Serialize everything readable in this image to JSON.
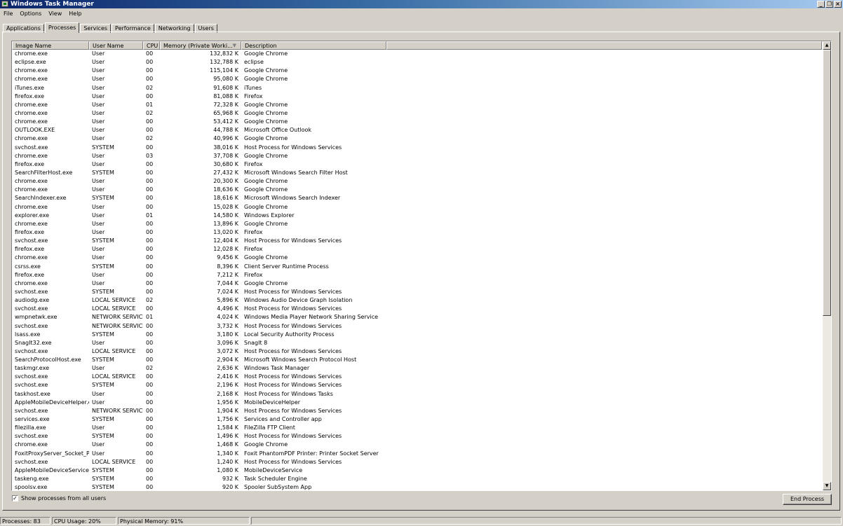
{
  "window": {
    "title": "Windows Task Manager"
  },
  "menu": [
    "File",
    "Options",
    "View",
    "Help"
  ],
  "tabs": [
    "Applications",
    "Processes",
    "Services",
    "Performance",
    "Networking",
    "Users"
  ],
  "active_tab": "Processes",
  "columns": [
    "Image Name",
    "User Name",
    "CPU",
    "Memory (Private Worki...",
    "Description"
  ],
  "processes": [
    {
      "name": "chrome.exe",
      "user": "User",
      "cpu": "00",
      "mem": "132,832 K",
      "desc": "Google Chrome"
    },
    {
      "name": "eclipse.exe",
      "user": "User",
      "cpu": "00",
      "mem": "132,788 K",
      "desc": "eclipse"
    },
    {
      "name": "chrome.exe",
      "user": "User",
      "cpu": "00",
      "mem": "115,104 K",
      "desc": "Google Chrome"
    },
    {
      "name": "chrome.exe",
      "user": "User",
      "cpu": "00",
      "mem": "95,080 K",
      "desc": "Google Chrome"
    },
    {
      "name": "iTunes.exe",
      "user": "User",
      "cpu": "02",
      "mem": "91,608 K",
      "desc": "iTunes"
    },
    {
      "name": "firefox.exe",
      "user": "User",
      "cpu": "00",
      "mem": "81,088 K",
      "desc": "Firefox"
    },
    {
      "name": "chrome.exe",
      "user": "User",
      "cpu": "01",
      "mem": "72,328 K",
      "desc": "Google Chrome"
    },
    {
      "name": "chrome.exe",
      "user": "User",
      "cpu": "02",
      "mem": "65,968 K",
      "desc": "Google Chrome"
    },
    {
      "name": "chrome.exe",
      "user": "User",
      "cpu": "00",
      "mem": "53,412 K",
      "desc": "Google Chrome"
    },
    {
      "name": "OUTLOOK.EXE",
      "user": "User",
      "cpu": "00",
      "mem": "44,788 K",
      "desc": "Microsoft Office Outlook"
    },
    {
      "name": "chrome.exe",
      "user": "User",
      "cpu": "02",
      "mem": "40,996 K",
      "desc": "Google Chrome"
    },
    {
      "name": "svchost.exe",
      "user": "SYSTEM",
      "cpu": "00",
      "mem": "38,016 K",
      "desc": "Host Process for Windows Services"
    },
    {
      "name": "chrome.exe",
      "user": "User",
      "cpu": "03",
      "mem": "37,708 K",
      "desc": "Google Chrome"
    },
    {
      "name": "firefox.exe",
      "user": "User",
      "cpu": "00",
      "mem": "30,680 K",
      "desc": "Firefox"
    },
    {
      "name": "SearchFilterHost.exe",
      "user": "SYSTEM",
      "cpu": "00",
      "mem": "27,432 K",
      "desc": "Microsoft Windows Search Filter Host"
    },
    {
      "name": "chrome.exe",
      "user": "User",
      "cpu": "00",
      "mem": "20,300 K",
      "desc": "Google Chrome"
    },
    {
      "name": "chrome.exe",
      "user": "User",
      "cpu": "00",
      "mem": "18,636 K",
      "desc": "Google Chrome"
    },
    {
      "name": "SearchIndexer.exe",
      "user": "SYSTEM",
      "cpu": "00",
      "mem": "18,616 K",
      "desc": "Microsoft Windows Search Indexer"
    },
    {
      "name": "chrome.exe",
      "user": "User",
      "cpu": "00",
      "mem": "15,028 K",
      "desc": "Google Chrome"
    },
    {
      "name": "explorer.exe",
      "user": "User",
      "cpu": "01",
      "mem": "14,580 K",
      "desc": "Windows Explorer"
    },
    {
      "name": "chrome.exe",
      "user": "User",
      "cpu": "00",
      "mem": "13,896 K",
      "desc": "Google Chrome"
    },
    {
      "name": "firefox.exe",
      "user": "User",
      "cpu": "00",
      "mem": "13,020 K",
      "desc": "Firefox"
    },
    {
      "name": "svchost.exe",
      "user": "SYSTEM",
      "cpu": "00",
      "mem": "12,404 K",
      "desc": "Host Process for Windows Services"
    },
    {
      "name": "firefox.exe",
      "user": "User",
      "cpu": "00",
      "mem": "12,028 K",
      "desc": "Firefox"
    },
    {
      "name": "chrome.exe",
      "user": "User",
      "cpu": "00",
      "mem": "9,456 K",
      "desc": "Google Chrome"
    },
    {
      "name": "csrss.exe",
      "user": "SYSTEM",
      "cpu": "00",
      "mem": "8,396 K",
      "desc": "Client Server Runtime Process"
    },
    {
      "name": "firefox.exe",
      "user": "User",
      "cpu": "00",
      "mem": "7,212 K",
      "desc": "Firefox"
    },
    {
      "name": "chrome.exe",
      "user": "User",
      "cpu": "00",
      "mem": "7,044 K",
      "desc": "Google Chrome"
    },
    {
      "name": "svchost.exe",
      "user": "SYSTEM",
      "cpu": "00",
      "mem": "7,024 K",
      "desc": "Host Process for Windows Services"
    },
    {
      "name": "audiodg.exe",
      "user": "LOCAL SERVICE",
      "cpu": "02",
      "mem": "5,896 K",
      "desc": "Windows Audio Device Graph Isolation"
    },
    {
      "name": "svchost.exe",
      "user": "LOCAL SERVICE",
      "cpu": "00",
      "mem": "4,496 K",
      "desc": "Host Process for Windows Services"
    },
    {
      "name": "wmpnetwk.exe",
      "user": "NETWORK SERVICE",
      "cpu": "01",
      "mem": "4,024 K",
      "desc": "Windows Media Player Network Sharing Service"
    },
    {
      "name": "svchost.exe",
      "user": "NETWORK SERVICE",
      "cpu": "00",
      "mem": "3,732 K",
      "desc": "Host Process for Windows Services"
    },
    {
      "name": "lsass.exe",
      "user": "SYSTEM",
      "cpu": "00",
      "mem": "3,180 K",
      "desc": "Local Security Authority Process"
    },
    {
      "name": "SnagIt32.exe",
      "user": "User",
      "cpu": "00",
      "mem": "3,096 K",
      "desc": "SnagIt 8"
    },
    {
      "name": "svchost.exe",
      "user": "LOCAL SERVICE",
      "cpu": "00",
      "mem": "3,072 K",
      "desc": "Host Process for Windows Services"
    },
    {
      "name": "SearchProtocolHost.exe",
      "user": "SYSTEM",
      "cpu": "00",
      "mem": "2,904 K",
      "desc": "Microsoft Windows Search Protocol Host"
    },
    {
      "name": "taskmgr.exe",
      "user": "User",
      "cpu": "02",
      "mem": "2,636 K",
      "desc": "Windows Task Manager"
    },
    {
      "name": "svchost.exe",
      "user": "LOCAL SERVICE",
      "cpu": "00",
      "mem": "2,416 K",
      "desc": "Host Process for Windows Services"
    },
    {
      "name": "svchost.exe",
      "user": "SYSTEM",
      "cpu": "00",
      "mem": "2,196 K",
      "desc": "Host Process for Windows Services"
    },
    {
      "name": "taskhost.exe",
      "user": "User",
      "cpu": "00",
      "mem": "2,168 K",
      "desc": "Host Process for Windows Tasks"
    },
    {
      "name": "AppleMobileDeviceHelper.exe",
      "user": "User",
      "cpu": "00",
      "mem": "1,956 K",
      "desc": "MobileDeviceHelper"
    },
    {
      "name": "svchost.exe",
      "user": "NETWORK SERVICE",
      "cpu": "00",
      "mem": "1,904 K",
      "desc": "Host Process for Windows Services"
    },
    {
      "name": "services.exe",
      "user": "SYSTEM",
      "cpu": "00",
      "mem": "1,756 K",
      "desc": "Services and Controller app"
    },
    {
      "name": "filezilla.exe",
      "user": "User",
      "cpu": "00",
      "mem": "1,584 K",
      "desc": "FileZilla FTP Client"
    },
    {
      "name": "svchost.exe",
      "user": "SYSTEM",
      "cpu": "00",
      "mem": "1,496 K",
      "desc": "Host Process for Windows Services"
    },
    {
      "name": "chrome.exe",
      "user": "User",
      "cpu": "00",
      "mem": "1,468 K",
      "desc": "Google Chrome"
    },
    {
      "name": "FoxitProxyServer_Socket_P...",
      "user": "User",
      "cpu": "00",
      "mem": "1,340 K",
      "desc": "Foxit PhantomPDF Printer: Printer Socket Server"
    },
    {
      "name": "svchost.exe",
      "user": "LOCAL SERVICE",
      "cpu": "00",
      "mem": "1,240 K",
      "desc": "Host Process for Windows Services"
    },
    {
      "name": "AppleMobileDeviceService.exe",
      "user": "SYSTEM",
      "cpu": "00",
      "mem": "1,080 K",
      "desc": "MobileDeviceService"
    },
    {
      "name": "taskeng.exe",
      "user": "SYSTEM",
      "cpu": "00",
      "mem": "932 K",
      "desc": "Task Scheduler Engine"
    },
    {
      "name": "spoolsv.exe",
      "user": "SYSTEM",
      "cpu": "00",
      "mem": "920 K",
      "desc": "Spooler SubSystem App"
    }
  ],
  "show_all_users": {
    "label": "Show processes from all users",
    "checked": true
  },
  "end_process_label": "End Process",
  "status": {
    "processes": "Processes: 83",
    "cpu": "CPU Usage: 20%",
    "memory": "Physical Memory: 91%"
  },
  "colors": {
    "title_start": "#0a246a",
    "title_end": "#a6caf0",
    "face": "#d4d0c8"
  }
}
